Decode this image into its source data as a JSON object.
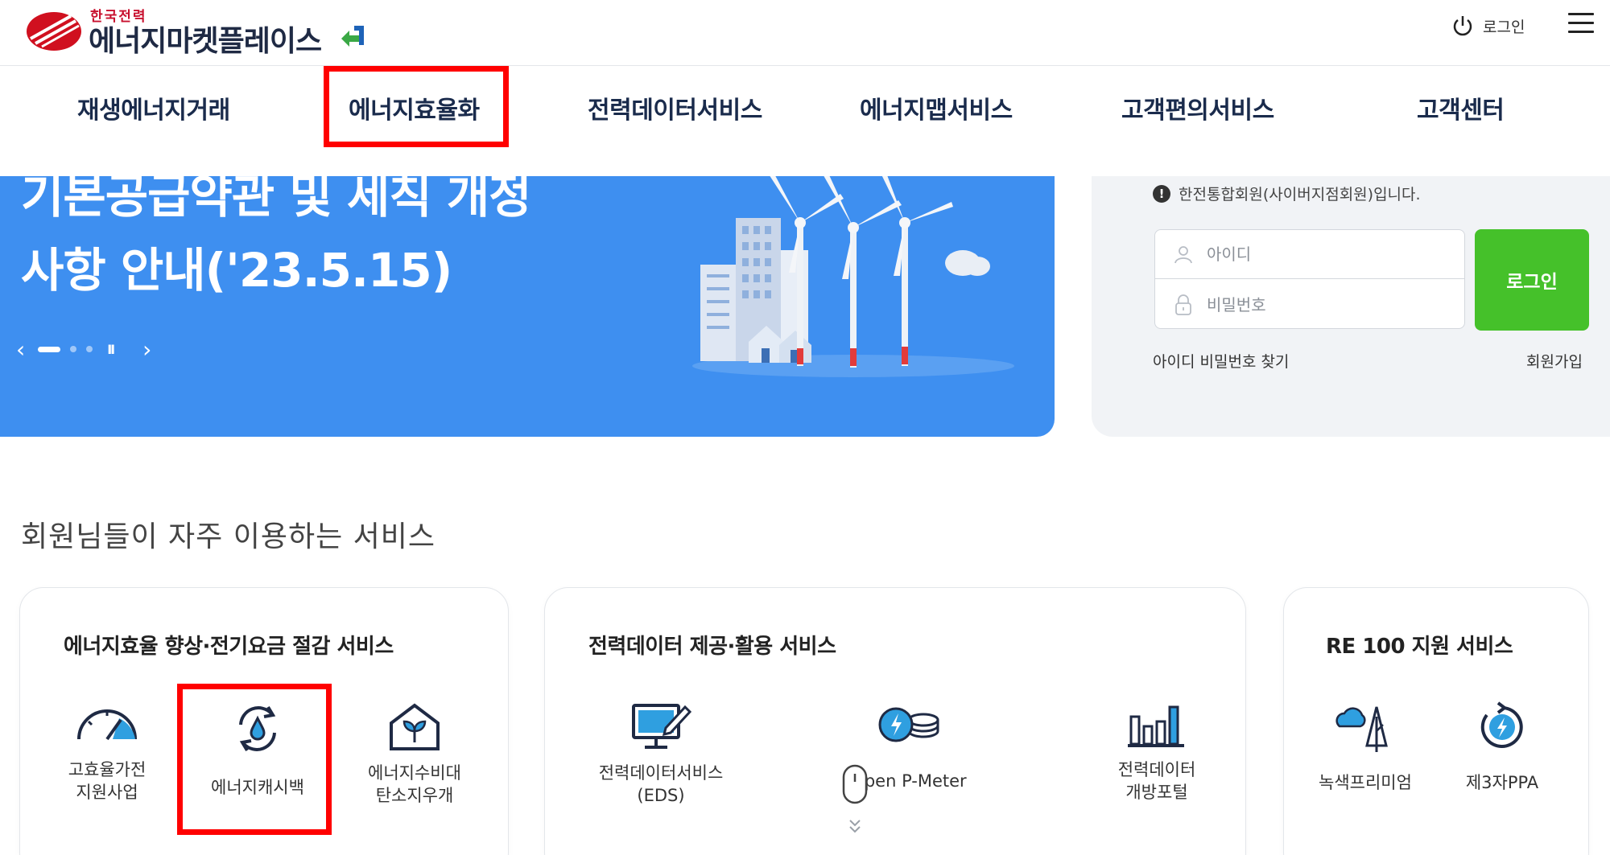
{
  "header": {
    "logo_small": "한국전력",
    "logo_main": "에너지마켓플레이스",
    "login_label": "로그인",
    "icons": {
      "power": "power-icon",
      "menu": "hamburger-menu-icon"
    }
  },
  "gnb": {
    "items": [
      "재생에너지거래",
      "에너지효율화",
      "전력데이터서비스",
      "에너지맵서비스",
      "고객편의서비스",
      "고객센터"
    ],
    "highlighted_index": 1
  },
  "banner": {
    "title_line1": "기본공급약관 및 세칙 개정",
    "title_line2": "사항 안내('23.5.15)",
    "prev": "‹",
    "next": "›",
    "pause": "II"
  },
  "login": {
    "notice": "한전통합회원(사이버지점회원)입니다.",
    "id_placeholder": "아이디",
    "pw_placeholder": "비밀번호",
    "button": "로그인",
    "find_link": "아이디 비밀번호 찾기",
    "join_link": "회원가입"
  },
  "section": {
    "title": "회원님들이 자주 이용하는 서비스",
    "cards": [
      {
        "title": "에너지효율 향상·전기요금 절감 서비스",
        "services": [
          "고효율가전\n지원사업",
          "에너지캐시백",
          "에너지수비대\n탄소지우개"
        ]
      },
      {
        "title": "전력데이터 제공·활용 서비스",
        "services": [
          "전력데이터서비스\n(EDS)",
          "Open P-Meter",
          "전력데이터\n개방포털"
        ]
      },
      {
        "title": "RE 100 지원 서비스",
        "services": [
          "녹색프리미엄",
          "제3자PPA"
        ]
      }
    ]
  },
  "colors": {
    "banner_blue": "#3e8ff0",
    "login_green": "#45c12a",
    "highlight_red": "#ff0000",
    "icon_navy": "#1f2a44",
    "icon_accent": "#2f9fe0"
  }
}
